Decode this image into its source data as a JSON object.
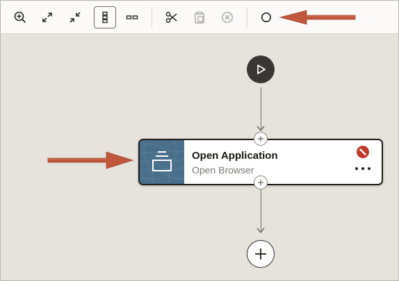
{
  "toolbar": {
    "buttons": [
      {
        "name": "zoom-in",
        "icon": "zoom-in-icon"
      },
      {
        "name": "expand",
        "icon": "expand-icon"
      },
      {
        "name": "collapse",
        "icon": "collapse-icon"
      },
      {
        "name": "vertical-layout",
        "icon": "vertical-layout-icon",
        "selected": true
      },
      {
        "name": "horizontal-layout",
        "icon": "horizontal-layout-icon"
      },
      {
        "name": "cut",
        "icon": "scissors-icon"
      },
      {
        "name": "paste",
        "icon": "clipboard-icon",
        "disabled": true
      },
      {
        "name": "delete",
        "icon": "circle-x-icon",
        "disabled": true
      },
      {
        "name": "breakpoint",
        "icon": "circle-icon"
      }
    ]
  },
  "step": {
    "title": "Open Application",
    "subtitle": "Open Browser",
    "status_icon": "error-no-entry-icon",
    "menu_icon": "more-dots-icon"
  },
  "colors": {
    "callout_arrow": "#c0573b",
    "canvas": "#e6e2dc",
    "start_node": "#3a3633",
    "status_error": "#c0392b",
    "step_icon_bg": "#4a6f8a"
  }
}
